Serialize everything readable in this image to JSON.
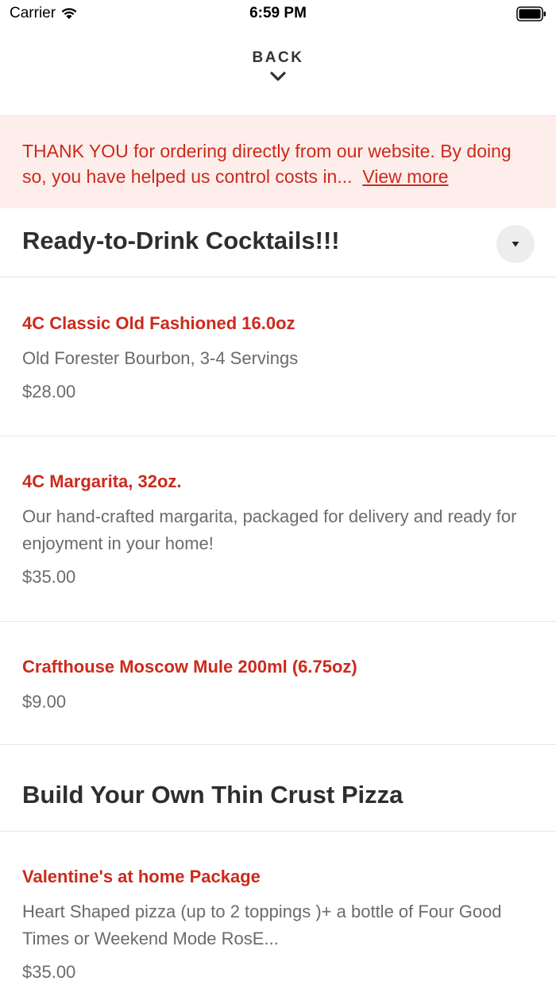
{
  "status_bar": {
    "carrier": "Carrier",
    "time": "6:59 PM"
  },
  "nav": {
    "back_label": "BACK"
  },
  "banner": {
    "text": "THANK YOU for ordering directly from our website. By doing so, you have helped us control costs in...",
    "link": "View more"
  },
  "sections": [
    {
      "title": "Ready-to-Drink Cocktails!!!",
      "items": [
        {
          "name": "4C Classic Old Fashioned 16.0oz",
          "description": "Old Forester Bourbon, 3-4 Servings",
          "price": "$28.00"
        },
        {
          "name": "4C Margarita, 32oz.",
          "description": "Our hand-crafted margarita, packaged for delivery and ready for enjoyment in your home!",
          "price": "$35.00"
        },
        {
          "name": "Crafthouse Moscow Mule 200ml (6.75oz)",
          "description": "",
          "price": "$9.00"
        }
      ]
    },
    {
      "title": "Build Your Own Thin Crust Pizza",
      "items": [
        {
          "name": "Valentine's at home Package",
          "description": "Heart Shaped pizza (up to 2 toppings )+ a bottle of Four Good Times or Weekend Mode RosE...",
          "price": "$35.00"
        }
      ]
    }
  ],
  "colors": {
    "accent": "#cc2a1c",
    "banner_bg": "#fdeeeb",
    "text_dark": "#2e2e2e",
    "text_muted": "#6b6b6b"
  }
}
